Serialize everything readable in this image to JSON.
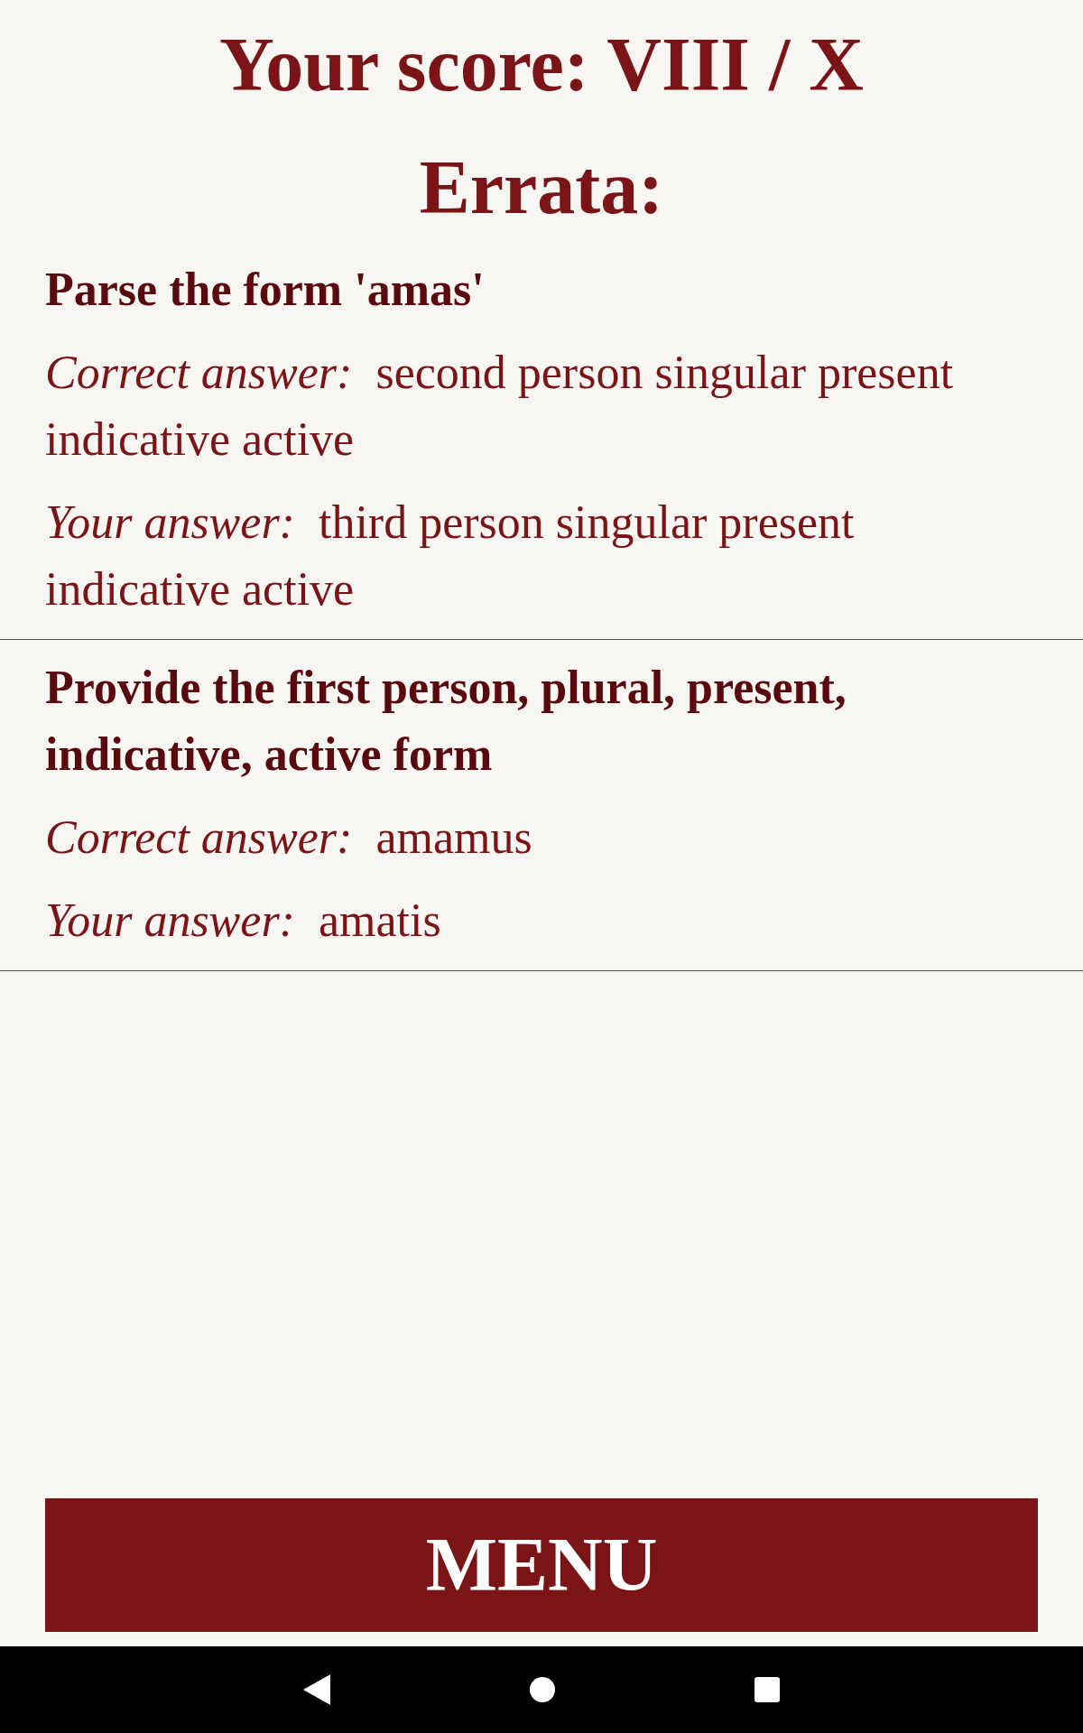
{
  "score_title": "Your score: VIII / X",
  "errata_heading": "Errata:",
  "errata": [
    {
      "question": "Parse the form 'amas'",
      "correct_label": "Correct answer:",
      "correct_answer": "second person singular present indicative active",
      "your_label": "Your answer:",
      "your_answer": "third person singular present indicative active"
    },
    {
      "question": "Provide the first person, plural, present, indicative, active form",
      "correct_label": "Correct answer:",
      "correct_answer": "amamus",
      "your_label": "Your answer:",
      "your_answer": "amatis"
    }
  ],
  "menu_button": "MENU"
}
